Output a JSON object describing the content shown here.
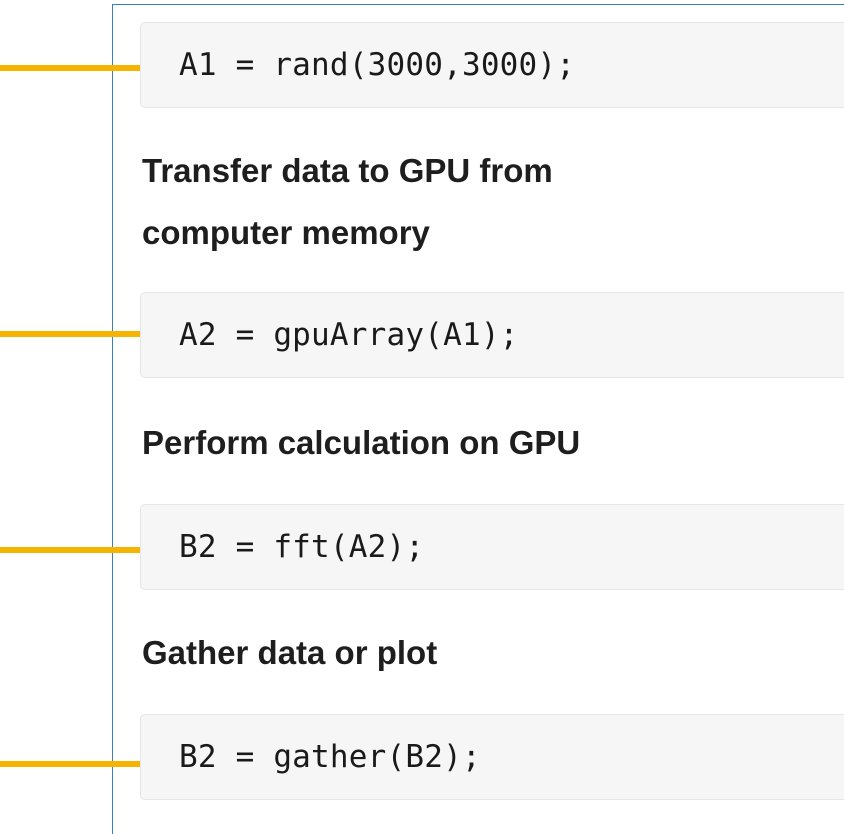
{
  "accent": {
    "arrow_color": "#f5b400",
    "panel_border_color": "#3a7fb8"
  },
  "steps": [
    {
      "code": "A1 = rand(3000,3000);"
    },
    {
      "heading": "Transfer data to GPU from computer memory",
      "heading_line1": "Transfer data to GPU from",
      "heading_line2": "computer memory",
      "code": "A2 = gpuArray(A1);"
    },
    {
      "heading": "Perform calculation on GPU",
      "code": "B2 = fft(A2);"
    },
    {
      "heading": "Gather data or plot",
      "code": "B2 = gather(B2);"
    }
  ],
  "icons": {
    "arrow": "right-arrow-icon"
  }
}
